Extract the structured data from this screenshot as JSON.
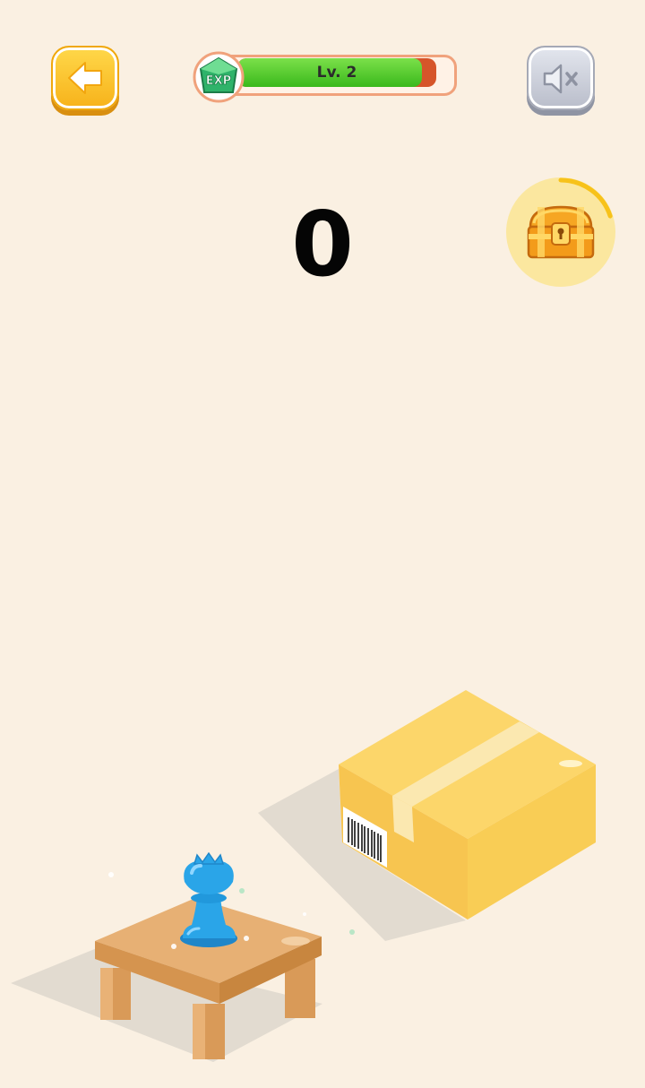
{
  "header": {
    "back_icon": "arrow-left-icon",
    "sound_icon": "speaker-muted-icon",
    "exp": {
      "badge_text": "EXP",
      "level_label": "Lv. 2",
      "progress_fraction": 0.93,
      "fill_color": "#3ab91c",
      "track_color": "#d6552a"
    }
  },
  "score": {
    "value": "0"
  },
  "reward": {
    "icon": "treasure-chest-icon",
    "ring_progress_fraction": 0.2,
    "ring_color": "#f7c21a"
  },
  "scene": {
    "piece_icon": "chess-queen-icon",
    "piece_color": "#2aa5e8",
    "table_color": "#e2a867",
    "box_color": "#f9c94e"
  }
}
